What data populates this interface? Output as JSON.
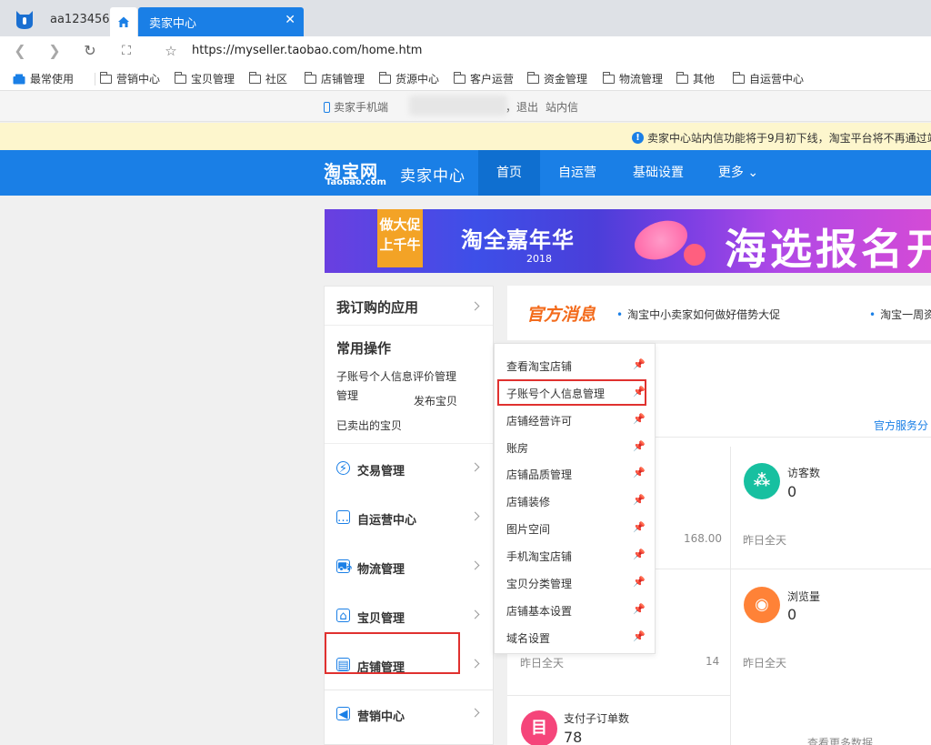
{
  "browser": {
    "user": "aa123456",
    "tab_title": "卖家中心",
    "tab_close": "✕",
    "url": "https://myseller.taobao.com/home.htm",
    "bookmarks": [
      "最常使用",
      "营销中心",
      "宝贝管理",
      "社区",
      "店铺管理",
      "货源中心",
      "客户运营",
      "资金管理",
      "物流管理",
      "其他",
      "自运营中心"
    ]
  },
  "topnav": {
    "mobile": "卖家手机端",
    "logout": "，退出",
    "inbox": "站内信"
  },
  "notice": {
    "text": "卖家中心站内信功能将于9月初下线，淘宝平台将不再通过站"
  },
  "header": {
    "logo": "淘宝网",
    "logo_sub": "Taobao.com",
    "title": "卖家中心",
    "nav": [
      "首页",
      "自运营",
      "基础设置",
      "更多 ⌄"
    ]
  },
  "banner": {
    "tag_line1": "做大促",
    "tag_line2": "上千牛",
    "title": "淘全嘉年华",
    "year": "2018",
    "right_text": "海选报名开"
  },
  "sidebar": {
    "subscribed": "我订购的应用",
    "common_title": "常用操作",
    "common_ops": [
      "子账号个人信息评价管理",
      "管理",
      "发布宝贝",
      "已卖出的宝贝"
    ],
    "items": [
      {
        "label": "交易管理",
        "icon": "⚡"
      },
      {
        "label": "自运营中心",
        "icon": "…"
      },
      {
        "label": "物流管理",
        "icon": "⛟"
      },
      {
        "label": "宝贝管理",
        "icon": "⌂"
      },
      {
        "label": "店铺管理",
        "icon": "▤"
      },
      {
        "label": "营销中心",
        "icon": "◀"
      }
    ]
  },
  "flyout": {
    "items": [
      "查看淘宝店铺",
      "子账号个人信息管理",
      "店铺经营许可",
      "账房",
      "店铺品质管理",
      "店铺装修",
      "图片空间",
      "手机淘宝店铺",
      "宝贝分类管理",
      "店铺基本设置",
      "域名设置"
    ],
    "pin_glyph": "📌"
  },
  "messages": {
    "title": "官方消息",
    "items": [
      "淘宝中小卖家如何做好借势大促",
      "淘宝一周资"
    ]
  },
  "content": {
    "service_link": "官方服务分",
    "stats": {
      "left_top_value": "168.00",
      "visitors_label": "访客数",
      "visitors_value": "0",
      "visitors_foot": "昨日全天",
      "left_mid_foot": "昨日全天",
      "left_mid_value": "14",
      "pv_label": "浏览量",
      "pv_value": "0",
      "pv_foot": "昨日全天",
      "orders_label": "支付子订单数",
      "orders_value": "78",
      "more_data": "查看更多数据"
    }
  },
  "colors": {
    "brand_blue": "#1a7fe6",
    "highlight_red": "#e0312f",
    "visitors_green": "#17c0a0",
    "pv_orange": "#ff8237",
    "orders_pink": "#f5457a"
  }
}
